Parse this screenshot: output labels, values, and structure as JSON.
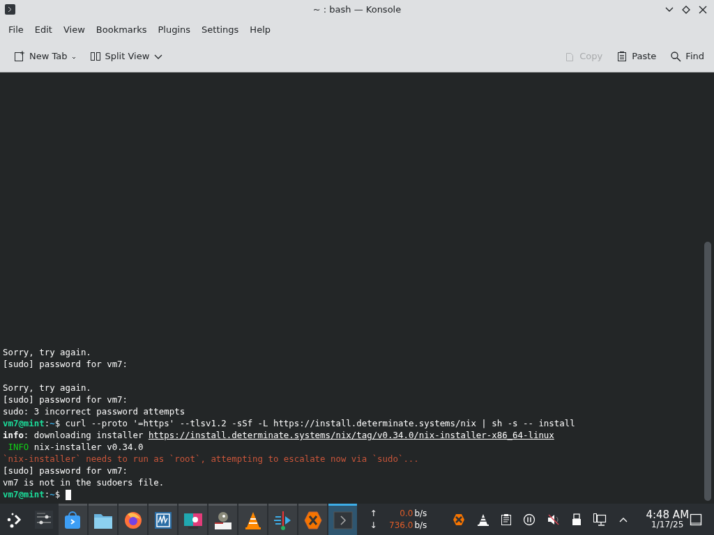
{
  "window": {
    "title": "~ : bash — Konsole"
  },
  "menu": [
    "File",
    "Edit",
    "View",
    "Bookmarks",
    "Plugins",
    "Settings",
    "Help"
  ],
  "toolbar": {
    "left": [
      {
        "label": "New Tab",
        "disabled": false
      },
      {
        "label": "Split View",
        "disabled": false
      }
    ],
    "right": [
      {
        "label": "Copy",
        "disabled": true
      },
      {
        "label": "Paste",
        "disabled": false
      },
      {
        "label": "Find",
        "disabled": false
      }
    ]
  },
  "terminal": {
    "lines": [
      {
        "segments": [
          {
            "text": "Sorry, try again.",
            "kind": "plain"
          }
        ]
      },
      {
        "segments": [
          {
            "text": "[sudo] password for vm7:",
            "kind": "plain"
          }
        ]
      },
      {
        "blank": true
      },
      {
        "segments": [
          {
            "text": "Sorry, try again.",
            "kind": "plain"
          }
        ]
      },
      {
        "segments": [
          {
            "text": "[sudo] password for vm7:",
            "kind": "plain"
          }
        ]
      },
      {
        "segments": [
          {
            "text": "sudo: 3 incorrect password attempts",
            "kind": "plain"
          }
        ]
      },
      {
        "segments": [
          {
            "text": "vm7@mint",
            "kind": "user"
          },
          {
            "text": ":",
            "kind": "plain"
          },
          {
            "text": "~",
            "kind": "path"
          },
          {
            "text": "$ curl --proto '=https' --tlsv1.2 -sSf -L https://install.determinate.systems/nix | sh -s -- install",
            "kind": "plain"
          }
        ]
      },
      {
        "segments": [
          {
            "text": "info",
            "kind": "bold"
          },
          {
            "text": ": downloading installer ",
            "kind": "plain"
          },
          {
            "text": "https://install.determinate.systems/nix/tag/v0.34.0/nix-installer-x86_64-linux",
            "kind": "link"
          }
        ]
      },
      {
        "segments": [
          {
            "text": " INFO",
            "kind": "info"
          },
          {
            "text": " nix-installer v0.34.0",
            "kind": "plain"
          }
        ]
      },
      {
        "segments": [
          {
            "text": "`nix-installer` needs to run as `root`, attempting to escalate now via `sudo`...",
            "kind": "warn"
          }
        ]
      },
      {
        "segments": [
          {
            "text": "[sudo] password for vm7:",
            "kind": "plain"
          }
        ]
      },
      {
        "segments": [
          {
            "text": "vm7 is not in the sudoers file.",
            "kind": "plain"
          }
        ]
      },
      {
        "segments": [
          {
            "text": "vm7@mint",
            "kind": "user"
          },
          {
            "text": ":",
            "kind": "plain"
          },
          {
            "text": "~",
            "kind": "path"
          },
          {
            "text": "$ ",
            "kind": "plain"
          }
        ],
        "cursor": true
      }
    ]
  },
  "taskbar": {
    "tasks": [
      {
        "selected": false
      },
      {
        "selected": false
      },
      {
        "selected": false
      },
      {
        "selected": false
      },
      {
        "selected": false
      },
      {
        "selected": false
      },
      {
        "selected": false
      },
      {
        "selected": false
      },
      {
        "selected": false
      },
      {
        "selected": true
      }
    ],
    "network": {
      "up_arrow": "↑",
      "up_value": "0.0",
      "up_unit": "b/s",
      "down_arrow": "↓",
      "down_value": "736.0",
      "down_unit": "b/s"
    },
    "clock": {
      "time": "4:48 AM",
      "date": "1/17/25"
    }
  }
}
